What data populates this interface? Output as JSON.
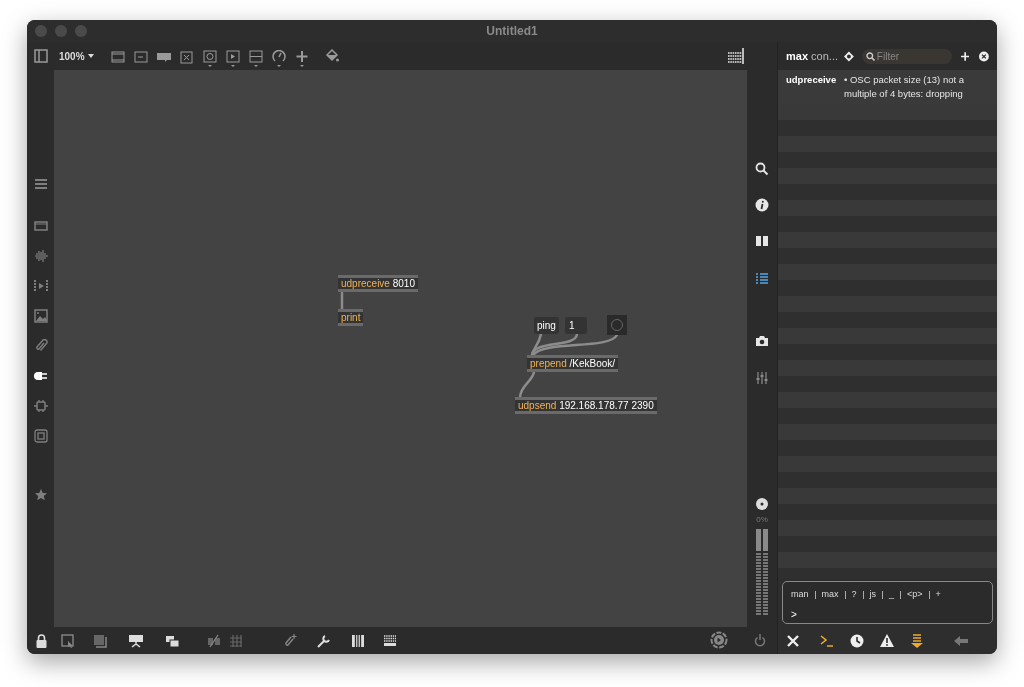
{
  "window": {
    "title": "Untitled1"
  },
  "toolbar": {
    "zoom": "100%"
  },
  "left_sidebar": [
    {
      "selected": false
    },
    {
      "selected": false
    },
    {
      "selected": false
    },
    {
      "selected": false
    },
    {
      "selected": false
    },
    {
      "selected": false
    },
    {
      "selected": true
    },
    {
      "selected": false
    },
    {
      "selected": false
    }
  ],
  "right_strip": [
    {
      "selected": false
    },
    {
      "selected": false
    },
    {
      "selected": false
    },
    {
      "selected": true
    },
    {
      "selected": false
    },
    {
      "selected": false
    }
  ],
  "patch": {
    "objects": [
      {
        "kind": "object",
        "name": "udpreceive",
        "args": "8010"
      },
      {
        "kind": "object",
        "name": "print"
      },
      {
        "kind": "message",
        "text": "ping"
      },
      {
        "kind": "number",
        "text": "1"
      },
      {
        "kind": "button"
      },
      {
        "kind": "object",
        "name": "prepend",
        "args": "/KekBook/"
      },
      {
        "kind": "object",
        "name": "udpsend",
        "args": "192.168.178.77 2390"
      }
    ]
  },
  "meter": {
    "reading": "0%"
  },
  "console": {
    "title": "max",
    "subtitle": "con...",
    "filter_placeholder": "Filter",
    "messages": [
      {
        "source": "udpreceive",
        "text": "• OSC packet size (13) not a multiple of 4 bytes: dropping"
      }
    ],
    "shortcuts": [
      "man",
      "max",
      "?",
      "js",
      "_",
      "<p>",
      "+"
    ],
    "prompt": ">",
    "buttons": [
      {
        "on": false
      },
      {
        "on": true
      },
      {
        "on": false
      },
      {
        "on": false
      },
      {
        "on": true
      },
      {
        "on": false
      }
    ]
  }
}
